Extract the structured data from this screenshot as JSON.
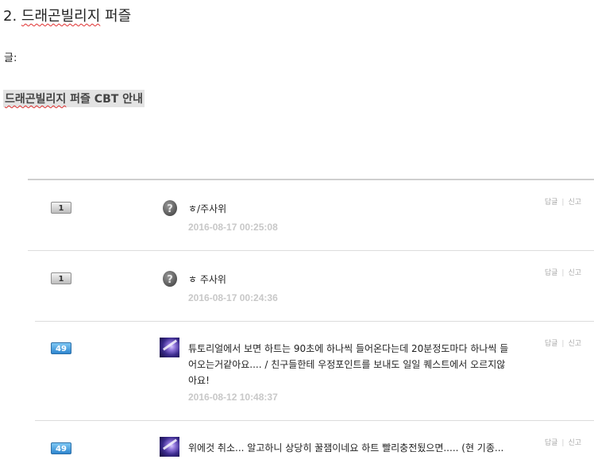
{
  "header": {
    "title_number": "2.",
    "title_name": "드래곤빌리지",
    "title_rest": "퍼즐"
  },
  "post": {
    "label": "글:",
    "notice_underlined": "드래곤빌리지",
    "notice_rest": " 퍼즐 CBT 안내"
  },
  "action_labels": {
    "reply": "답글",
    "report": "신고",
    "separator": "|"
  },
  "comments": [
    {
      "level": "1",
      "avatar_icon": "question-egg-icon",
      "text": "ㅎ/주사위",
      "date": "2016-08-17 00:25:08"
    },
    {
      "level": "1",
      "avatar_icon": "question-egg-icon",
      "text": "ㅎ 주사위",
      "date": "2016-08-17 00:24:36"
    },
    {
      "level": "49",
      "avatar_icon": "user-photo",
      "text": "튜토리얼에서 보면 하트는 90초에 하나씩 들어온다는데 20분정도마다 하나씩 들어오는거같아요.... / 친구들한테 우정포인트를 보내도 일일 퀘스트에서 오르지않아요!",
      "date": "2016-08-12 10:48:37"
    },
    {
      "level": "49",
      "avatar_icon": "user-photo",
      "text": "위에것 취소... 알고하니 상당히 꿀잼이네요 하트 빨리충전됬으면..... (현 기종...",
      "date": ""
    }
  ],
  "colors": {
    "badge_gray": "#c8c8c8",
    "badge_blue": "#3f97dc",
    "date_text": "#c8c8c8",
    "notice_bg": "#e3e3e3"
  }
}
